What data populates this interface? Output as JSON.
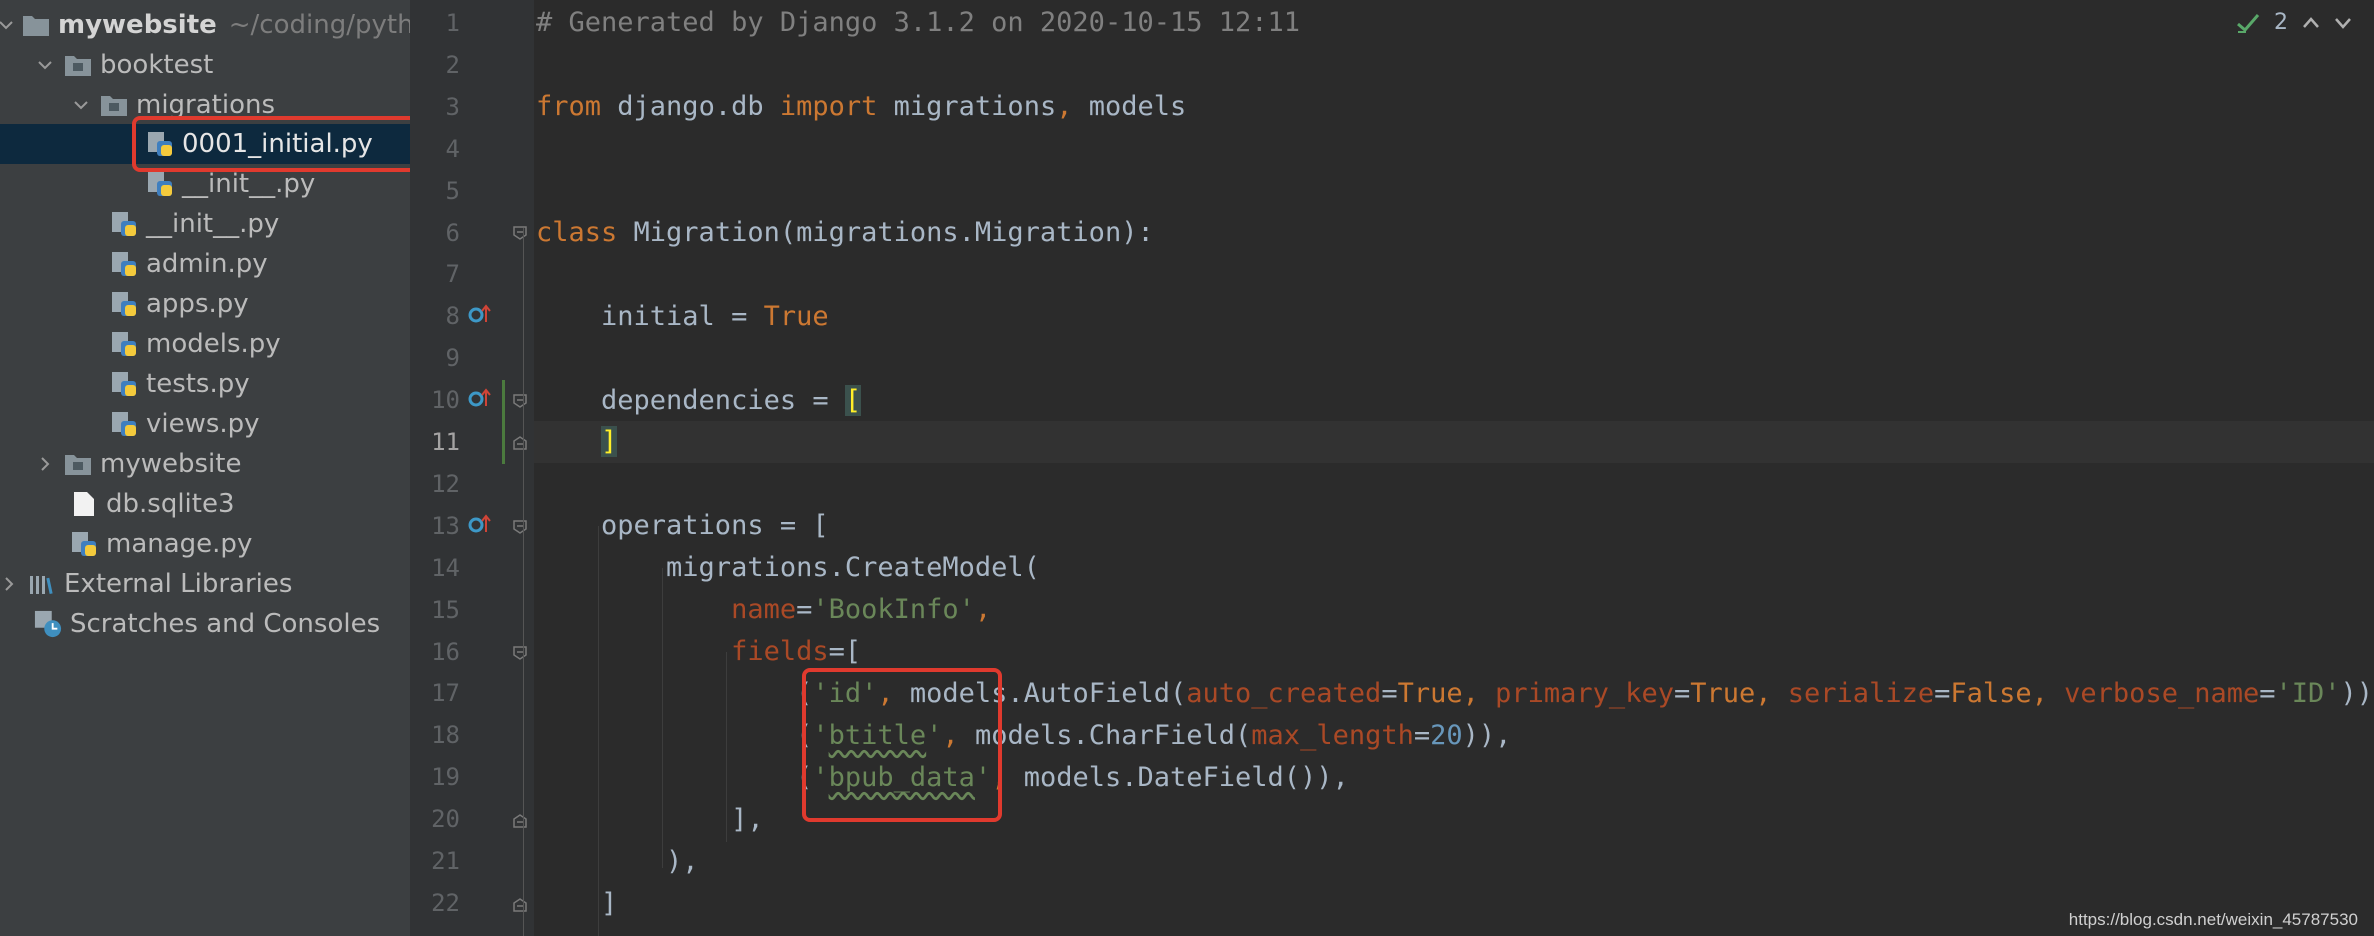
{
  "project_tree": {
    "items": [
      {
        "label": "mywebsite",
        "hint": "~/coding/pyth",
        "kind": "folder",
        "expanded": true
      },
      {
        "label": "booktest",
        "kind": "folder",
        "expanded": true
      },
      {
        "label": "migrations",
        "kind": "folder",
        "expanded": true
      },
      {
        "label": "0001_initial.py",
        "kind": "python",
        "selected": true
      },
      {
        "label": "__init__.py",
        "kind": "python"
      },
      {
        "label": "__init__.py",
        "kind": "python"
      },
      {
        "label": "admin.py",
        "kind": "python"
      },
      {
        "label": "apps.py",
        "kind": "python"
      },
      {
        "label": "models.py",
        "kind": "python"
      },
      {
        "label": "tests.py",
        "kind": "python"
      },
      {
        "label": "views.py",
        "kind": "python"
      },
      {
        "label": "mywebsite",
        "kind": "folder",
        "expanded": false
      },
      {
        "label": "db.sqlite3",
        "kind": "file"
      },
      {
        "label": "manage.py",
        "kind": "python"
      },
      {
        "label": "External Libraries",
        "kind": "libraries",
        "expanded": false
      },
      {
        "label": "Scratches and Consoles",
        "kind": "scratches"
      }
    ]
  },
  "editor": {
    "line_numbers": [
      "1",
      "2",
      "3",
      "4",
      "5",
      "6",
      "7",
      "8",
      "9",
      "10",
      "11",
      "12",
      "13",
      "14",
      "15",
      "16",
      "17",
      "18",
      "19",
      "20",
      "21",
      "22"
    ],
    "current_line": "11",
    "inspection_count": "2",
    "code": {
      "l1": "# Generated by Django 3.1.2 on 2020-10-15 12:11",
      "l3": {
        "from": "from",
        "mod": " django.db ",
        "imp": "import",
        "rest": " migrations",
        "comma": ",",
        "models": " models"
      },
      "l6": {
        "kw": "class",
        "rest": " Migration(migrations.Migration):"
      },
      "l8": {
        "name": "    initial = ",
        "val": "True"
      },
      "l10": {
        "name": "    dependencies = ",
        "bracket": "["
      },
      "l11": {
        "indent": "    ",
        "bracket": "]"
      },
      "l13": "    operations = [",
      "l14": "        migrations.CreateModel(",
      "l15": {
        "indent": "            ",
        "param": "name",
        "eq": "=",
        "str": "'BookInfo'",
        "comma": ","
      },
      "l16": {
        "indent": "            ",
        "param": "fields",
        "rest": "=["
      },
      "l17": {
        "a": "                (",
        "s1": "'id'",
        "c1": ",",
        "b": " models.AutoField(",
        "p1": "auto_created",
        "e1": "=",
        "v1": "True",
        "c2": ",",
        "p2": " primary_key",
        "e2": "=",
        "v2": "True",
        "c3": ",",
        "p3": " serialize",
        "e3": "=",
        "v3": "False",
        "c4": ",",
        "p4": " verbose_name",
        "e4": "=",
        "s2": "'ID'",
        "end": ")),"
      },
      "l18": {
        "a": "                (",
        "q1": "'",
        "word": "btitle",
        "q2": "'",
        "c1": ",",
        "b": " models.CharField(",
        "p": "max_length",
        "e": "=",
        "n": "20",
        "end": ")),"
      },
      "l19": {
        "a": "                (",
        "q1": "'",
        "word": "bpub_data",
        "q2": "'",
        "c1": ",",
        "b": " models.DateField()),"
      },
      "l20": "            ],",
      "l21": "        ),",
      "l22": "    ]"
    }
  },
  "watermark": "https://blog.csdn.net/weixin_45787530",
  "colors": {
    "highlight_box": "#e03a2e",
    "keyword": "#cc7832",
    "string": "#6a8759",
    "number": "#6897bb",
    "param": "#aa4926",
    "selection": "#0d293e"
  }
}
